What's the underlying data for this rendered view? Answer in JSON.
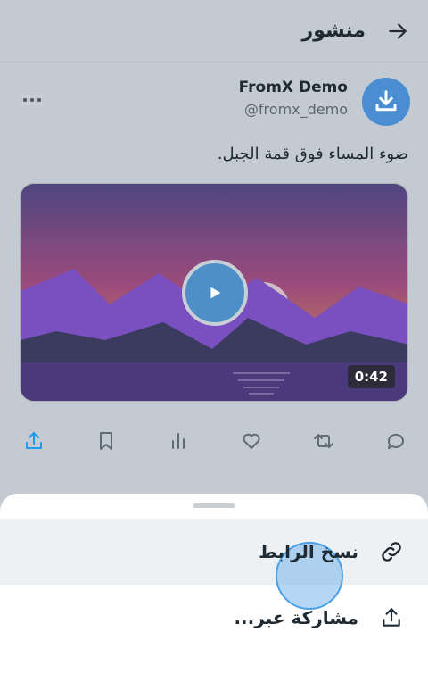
{
  "header": {
    "title": "منشور"
  },
  "post": {
    "display_name": "FromX Demo",
    "handle": "@fromx_demo",
    "text": "ضوء المساء فوق قمة الجبل.",
    "video_duration": "0:42"
  },
  "sheet": {
    "items": [
      {
        "label": "نسخ الرابط",
        "icon": "link-icon"
      },
      {
        "label": "مشاركة عبر...",
        "icon": "share-icon"
      }
    ]
  },
  "colors": {
    "avatar": "#4a8ed1",
    "accent": "#1d9bf0",
    "play": "#4d8fc6"
  }
}
